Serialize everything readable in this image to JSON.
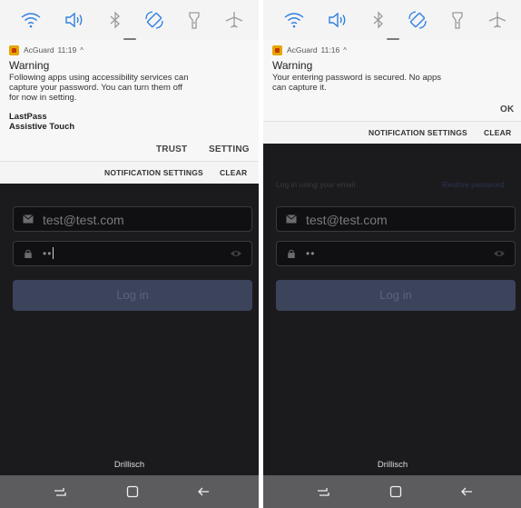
{
  "left": {
    "notification": {
      "app_name": "AcGuard",
      "time": "11:19",
      "caret": "^",
      "title": "Warning",
      "body_lines": [
        "Following apps using accessibility services can",
        "capture your password. You can turn them off",
        "for now in setting."
      ],
      "apps": [
        "LastPass",
        "Assistive Touch"
      ],
      "action_trust": "TRUST",
      "action_setting": "SETTING"
    },
    "footer": {
      "settings": "NOTIFICATION SETTINGS",
      "clear": "CLEAR"
    },
    "login": {
      "email_value": "test@test.com",
      "password_mask": "••",
      "button_label": "Log in"
    },
    "carrier": "Drillisch"
  },
  "right": {
    "notification": {
      "app_name": "AcGuard",
      "time": "11:16",
      "caret": "^",
      "title": "Warning",
      "body_lines": [
        "Your entering password is secured. No apps",
        "can capture it."
      ],
      "action_ok": "OK"
    },
    "footer": {
      "settings": "NOTIFICATION SETTINGS",
      "clear": "CLEAR"
    },
    "login": {
      "hint": "Log in using your email",
      "restore": "Restore password",
      "email_value": "test@test.com",
      "password_mask": "••",
      "button_label": "Log in"
    },
    "carrier": "Drillisch"
  },
  "quick_settings_icons": [
    "wifi-icon",
    "sound-icon",
    "bluetooth-icon",
    "auto-rotate-icon",
    "flashlight-icon",
    "airplane-mode-icon"
  ],
  "nav_icons": [
    "recents-icon",
    "home-icon",
    "back-icon"
  ],
  "colors": {
    "accent_qs": "#2f7fe0",
    "app_icon": "#e6a500",
    "login_button": "#3c445b",
    "navbar": "#5c5c5e"
  }
}
